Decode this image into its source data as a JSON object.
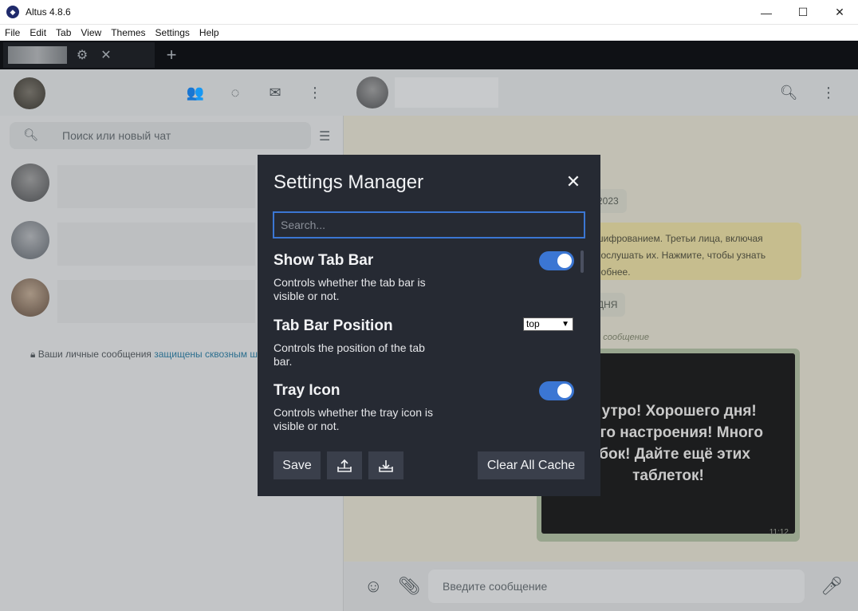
{
  "window": {
    "title": "Altus 4.8.6"
  },
  "menu": [
    "File",
    "Edit",
    "Tab",
    "View",
    "Themes",
    "Settings",
    "Help"
  ],
  "whatsapp": {
    "search_placeholder": "Поиск или новый чат",
    "privacy_prefix": "Ваши личные сообщения ",
    "privacy_link": "защищены сквозным ш",
    "date_chip_1": "2023",
    "date_chip_2": "ДНЯ",
    "system_message": "шифрованием. Третьи лица, включая\nпослушать их. Нажмите, чтобы узнать\nробнее.",
    "unread_label": "ое сообщение",
    "image_text": "ое утро! Хорошего дня!\nсного настроения! Много\nыбок! Дайте ещё этих\nтаблеток!",
    "image_time": "11:12",
    "composer_placeholder": "Введите сообщение"
  },
  "modal": {
    "title": "Settings Manager",
    "search_placeholder": "Search...",
    "settings": [
      {
        "title": "Show Tab Bar",
        "description": "Controls whether the tab bar is visible or not.",
        "control": "toggle",
        "value": true
      },
      {
        "title": "Tab Bar Position",
        "description": "Controls the position of the tab bar.",
        "control": "select",
        "value": "top"
      },
      {
        "title": "Tray Icon",
        "description": "Controls whether the tray icon is visible or not.",
        "control": "toggle",
        "value": true
      }
    ],
    "save_label": "Save",
    "clear_cache_label": "Clear All Cache"
  },
  "colors": {
    "modal_bg": "#262a33",
    "accent": "#3b76d3",
    "button_bg": "#3a3f4b"
  }
}
